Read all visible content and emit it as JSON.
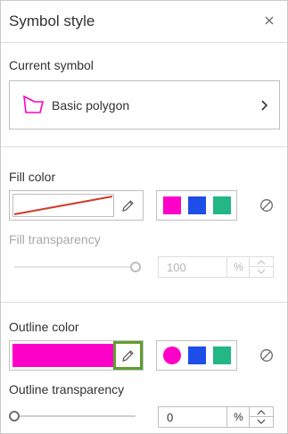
{
  "panel": {
    "title": "Symbol style"
  },
  "current_symbol": {
    "label": "Current symbol",
    "name": "Basic polygon"
  },
  "fill": {
    "label": "Fill color",
    "transparency_label": "Fill transparency",
    "transparency_value": "100",
    "transparency_unit": "%",
    "transparency_level": 1.0,
    "disabled": true,
    "swatches": [
      "#ff00c8",
      "#1d4ee8",
      "#22b784"
    ]
  },
  "outline": {
    "label": "Outline color",
    "color": "#ff00c8",
    "transparency_label": "Outline transparency",
    "transparency_value": "0",
    "transparency_unit": "%",
    "transparency_level": 0.0,
    "swatches": [
      "#ff00c8",
      "#1d4ee8",
      "#22b784"
    ]
  },
  "colors": {
    "accent_outline": "#5e9e2e",
    "no_fill_line": "#d03b2a"
  }
}
